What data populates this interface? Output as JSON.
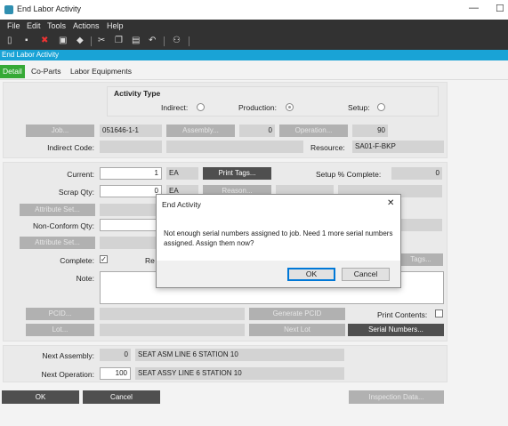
{
  "window": {
    "title": "End Labor Activity",
    "minimize_glyph": "—",
    "maximize_glyph": "☐"
  },
  "menu": {
    "items": [
      "File",
      "Edit",
      "Tools",
      "Actions",
      "Help"
    ]
  },
  "toolbar": {
    "icons": [
      "new-icon",
      "save-icon",
      "delete-icon",
      "clear-icon",
      "eraser-icon",
      "cut-icon",
      "copy-icon",
      "paste-icon",
      "undo-icon",
      "binoculars-icon"
    ]
  },
  "banner": {
    "title": "End Labor Activity"
  },
  "tabs": [
    "Detail",
    "Co-Parts",
    "Labor Equipments"
  ],
  "activity": {
    "heading": "Activity Type",
    "indirect": "Indirect:",
    "production": "Production:",
    "setup": "Setup:",
    "selected": "Production"
  },
  "job": {
    "job_button": "Job...",
    "job_value": "051646-1-1",
    "assembly_button": "Assembly...",
    "assembly_value": "0",
    "operation_button": "Operation...",
    "operation_value": "90",
    "indirect_code_label": "Indirect Code:",
    "resource_label": "Resource:",
    "resource_value": "SA01-F-BKP"
  },
  "quantities": {
    "current_label": "Current:",
    "current_value": "1",
    "current_uom": "EA",
    "print_tags": "Print Tags...",
    "setup_pct_label": "Setup % Complete:",
    "setup_pct_value": "0",
    "scrap_label": "Scrap Qty:",
    "scrap_value": "0",
    "scrap_uom": "EA",
    "reason_button": "Reason...",
    "attribute_set_1": "Attribute Set...",
    "nonconform_label": "Non-Conform Qty:",
    "attribute_set_2": "Attribute Set...",
    "complete_label": "Complete:",
    "complete_checked": "✓",
    "re_label": "Re",
    "tags_button": "Tags...",
    "note_label": "Note:"
  },
  "pcid": {
    "pcid_button": "PCID...",
    "generate_pcid": "Generate PCID",
    "print_contents_label": "Print Contents:",
    "lot_button": "Lot...",
    "next_lot": "Next Lot",
    "serial_numbers": "Serial Numbers..."
  },
  "next": {
    "assembly_label": "Next Assembly:",
    "assembly_num": "0",
    "assembly_desc": "SEAT ASM LINE 6 STATION 10",
    "operation_label": "Next Operation:",
    "operation_num": "100",
    "operation_desc": "SEAT ASSY LINE 6 STATION 10"
  },
  "footer": {
    "ok": "OK",
    "cancel": "Cancel",
    "inspection": "Inspection Data..."
  },
  "dialog": {
    "title": "End Activity",
    "close_glyph": "✕",
    "message": "Not enough serial numbers assigned to job. Need 1 more serial numbers assigned. Assign them now?",
    "ok": "OK",
    "cancel": "Cancel"
  },
  "colors": {
    "accent_blue": "#19a3d6",
    "tab_green": "#36a936",
    "dark_bar": "#323232"
  }
}
